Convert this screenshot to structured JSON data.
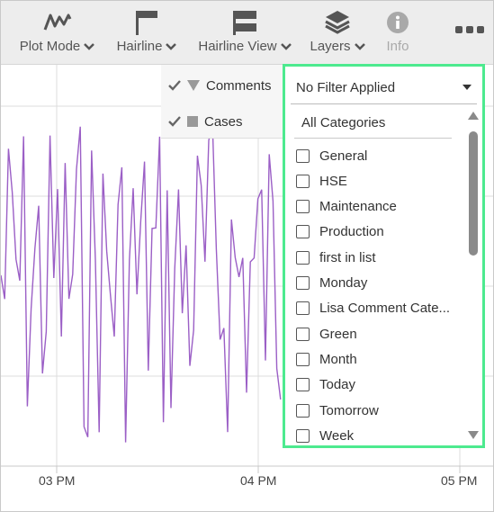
{
  "toolbar": {
    "plot_mode": "Plot Mode",
    "hairline": "Hairline",
    "hairline_view": "Hairline View",
    "layers": "Layers",
    "info": "Info"
  },
  "layers_panel": {
    "items": [
      {
        "label": "Comments",
        "checked": true,
        "symbol": "triangle"
      },
      {
        "label": "Cases",
        "checked": true,
        "symbol": "square"
      }
    ]
  },
  "filter": {
    "selected": "No Filter Applied",
    "all_label": "All Categories",
    "options": [
      "General",
      "HSE",
      "Maintenance",
      "Production",
      "first in list",
      "Monday",
      "Lisa Comment Cate...",
      "Green",
      "Month",
      "Today",
      "Tomorrow",
      "Week"
    ]
  },
  "chart_data": {
    "type": "line",
    "x_ticks": [
      "03 PM",
      "04 PM",
      "05 PM"
    ],
    "series_color": "#9b5fc6",
    "grid": true
  },
  "colors": {
    "accent_border": "#4dea8f",
    "series": "#9b5fc6"
  }
}
